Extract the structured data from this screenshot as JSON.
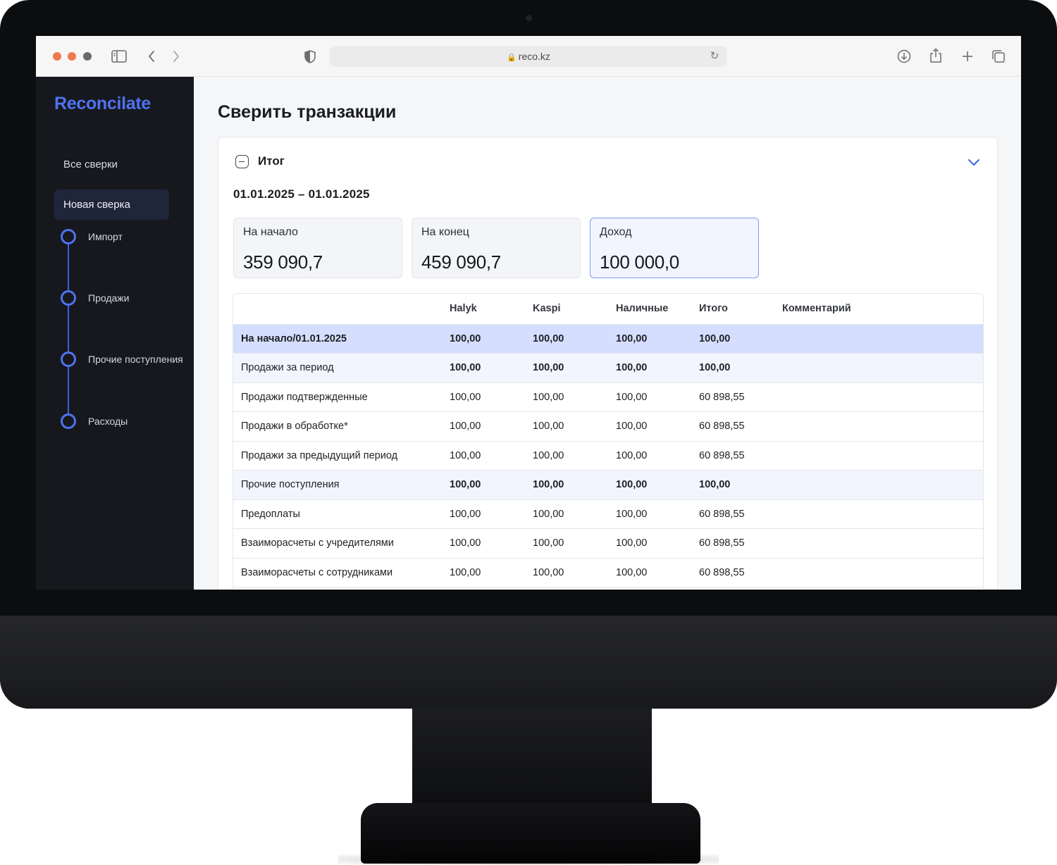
{
  "browser": {
    "url": "reco.kz"
  },
  "sidebar": {
    "brand": "Reconcilate",
    "nav": [
      {
        "label": "Все сверки"
      },
      {
        "label": "Новая сверка"
      }
    ],
    "steps": [
      {
        "label": "Импорт"
      },
      {
        "label": "Продажи"
      },
      {
        "label": "Прочие поступления"
      },
      {
        "label": "Расходы"
      }
    ]
  },
  "main": {
    "title": "Сверить транзакции",
    "card": {
      "title": "Итог",
      "period": "01.01.2025 – 01.01.2025",
      "kpis": [
        {
          "label": "На начало",
          "value": "359 090,7"
        },
        {
          "label": "На конец",
          "value": "459 090,7"
        },
        {
          "label": "Доход",
          "value": "100 000,0"
        }
      ]
    },
    "table": {
      "headers": [
        "",
        "Halyk",
        "Kaspi",
        "Наличные",
        "Итого",
        "Комментарий"
      ],
      "rows": [
        {
          "label": "На начало/01.01.2025",
          "halyk": "100,00",
          "kaspi": "100,00",
          "cash": "100,00",
          "total": "100,00",
          "comment": ""
        },
        {
          "label": "Продажи за период",
          "halyk": "100,00",
          "kaspi": "100,00",
          "cash": "100,00",
          "total": "100,00",
          "comment": ""
        },
        {
          "label": "Продажи подтвержденные",
          "halyk": "100,00",
          "kaspi": "100,00",
          "cash": "100,00",
          "total": "60 898,55",
          "comment": ""
        },
        {
          "label": "Продажи в обработке*",
          "halyk": "100,00",
          "kaspi": "100,00",
          "cash": "100,00",
          "total": "60 898,55",
          "comment": ""
        },
        {
          "label": "Продажи за предыдущий период",
          "halyk": "100,00",
          "kaspi": "100,00",
          "cash": "100,00",
          "total": "60 898,55",
          "comment": ""
        },
        {
          "label": "Прочие поступления",
          "halyk": "100,00",
          "kaspi": "100,00",
          "cash": "100,00",
          "total": "100,00",
          "comment": ""
        },
        {
          "label": "Предоплаты",
          "halyk": "100,00",
          "kaspi": "100,00",
          "cash": "100,00",
          "total": "60 898,55",
          "comment": ""
        },
        {
          "label": "Взаиморасчеты с учредителями",
          "halyk": "100,00",
          "kaspi": "100,00",
          "cash": "100,00",
          "total": "60 898,55",
          "comment": ""
        },
        {
          "label": "Взаиморасчеты с сотрудниками",
          "halyk": "100,00",
          "kaspi": "100,00",
          "cash": "100,00",
          "total": "60 898,55",
          "comment": ""
        }
      ]
    }
  },
  "colors": {
    "accent": "#4f72f0",
    "sidebar_bg": "#16181d",
    "selected_row": "#d6deff"
  }
}
